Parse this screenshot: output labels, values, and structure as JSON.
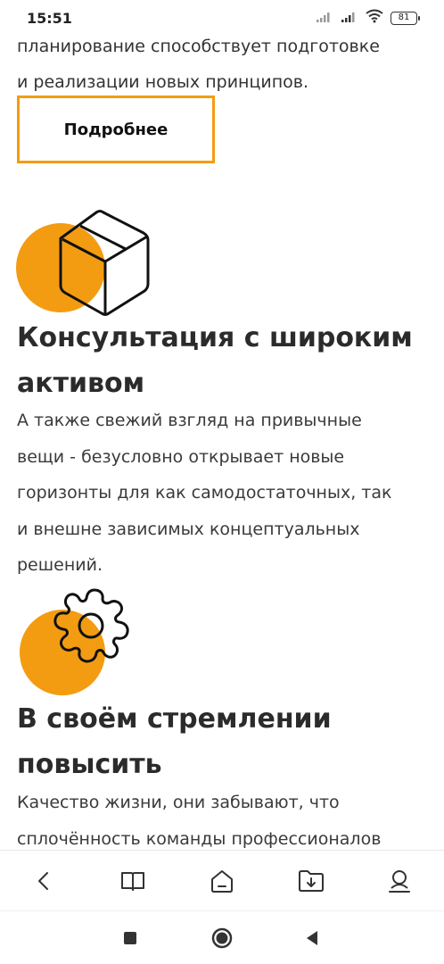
{
  "status_bar": {
    "time": "15:51",
    "battery": "81",
    "icons": [
      "signal-icon",
      "signal-icon",
      "wifi-icon",
      "battery-icon"
    ]
  },
  "intro": {
    "text_line1": "планирование способствует подготовке",
    "text_line2": "и реализации новых принципов.",
    "more_button": "Подробнее"
  },
  "features": [
    {
      "icon": "box-icon",
      "title_line1": "Консультация с широким",
      "title_line2": "активом",
      "text_lines": [
        "А также свежий взгляд на привычные",
        "вещи - безусловно открывает новые",
        "горизонты для как самодостаточных, так",
        "и внешне зависимых концептуальных",
        "решений."
      ]
    },
    {
      "icon": "gear-icon",
      "title_line1": "В своём стремлении",
      "title_line2": "повысить",
      "text_lines": [
        "Качество жизни, они забывают, что",
        "сплочённость команды профессионалов"
      ]
    }
  ],
  "colors": {
    "accent": "#f39c12",
    "text": "#2b2b2b"
  },
  "browser_nav": [
    "back-icon",
    "book-icon",
    "home-icon",
    "download-folder-icon",
    "profile-icon"
  ],
  "system_nav": [
    "square-icon",
    "circle-icon",
    "triangle-back-icon"
  ]
}
